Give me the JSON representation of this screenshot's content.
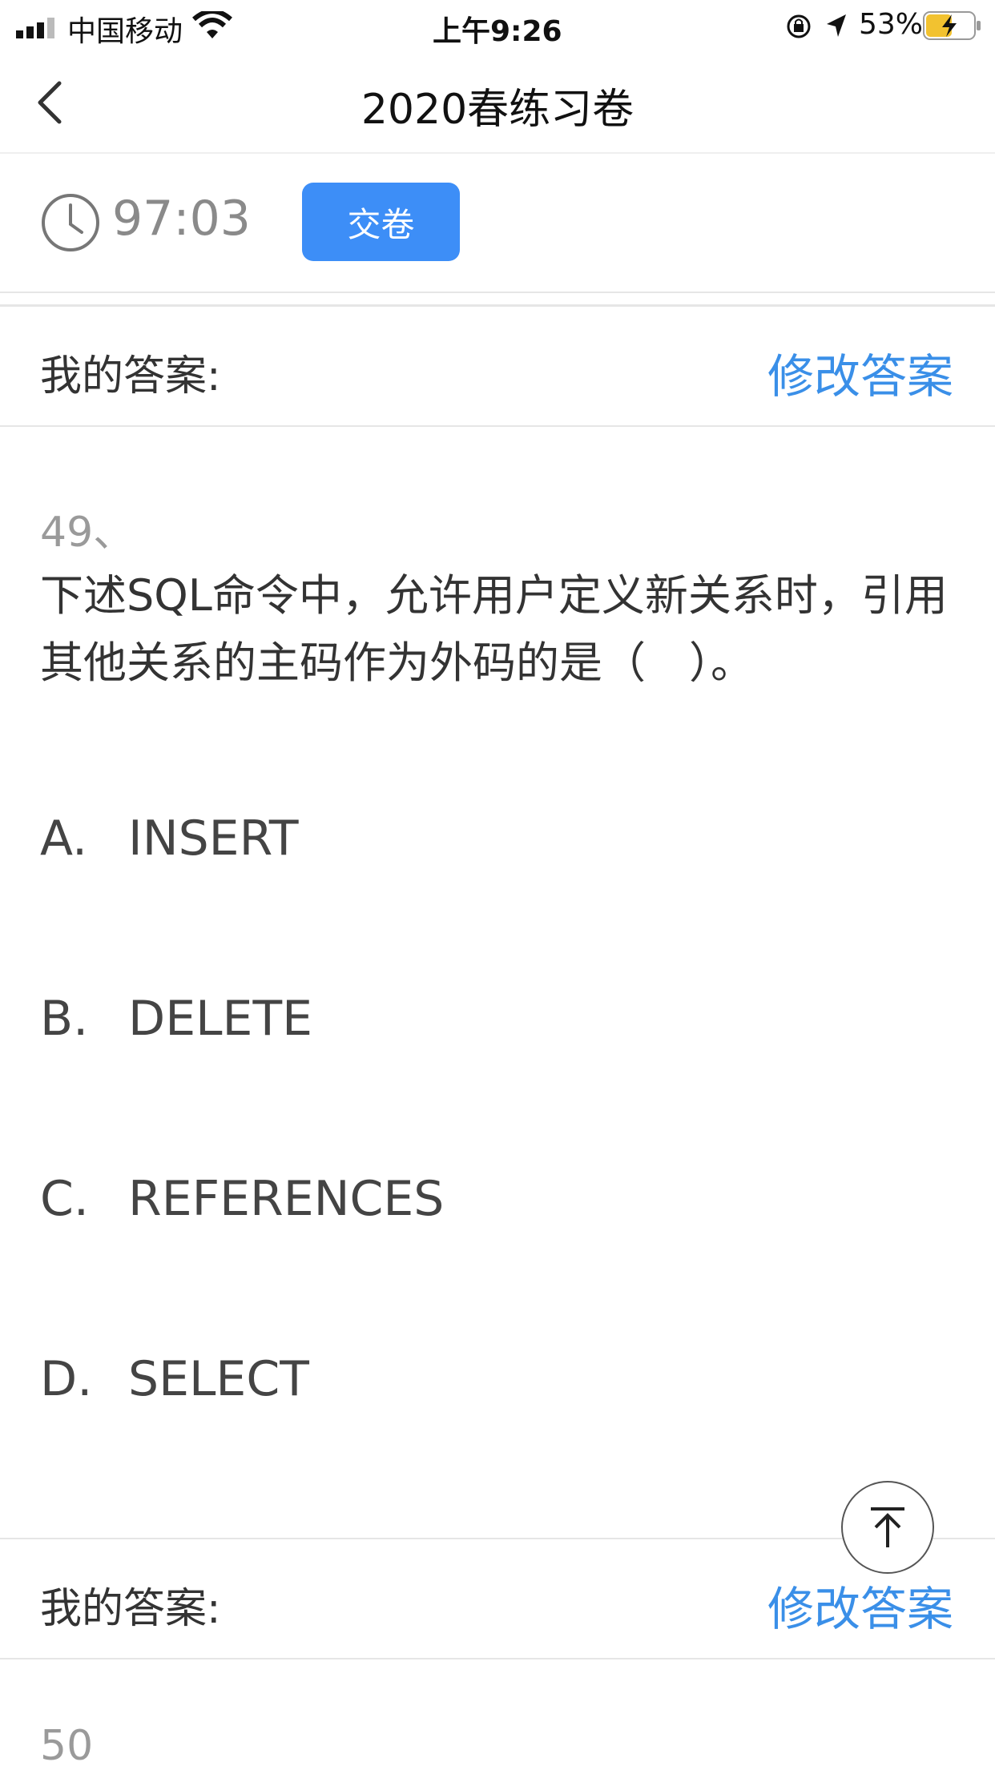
{
  "status_bar": {
    "carrier": "中国移动",
    "time": "上午9:26",
    "battery_percent": "53%",
    "battery_level": 0.53
  },
  "nav": {
    "title": "2020春练习卷"
  },
  "timer": {
    "value": "97:03",
    "submit_label": "交卷"
  },
  "answer_bar_top": {
    "label": "我的答案:",
    "edit_label": "修改答案"
  },
  "question": {
    "number": "49、",
    "text": "下述SQL命令中，允许用户定义新关系时，引用其他关系的主码作为外码的是（　）。",
    "options": [
      {
        "letter": "A.",
        "text": "INSERT"
      },
      {
        "letter": "B.",
        "text": "DELETE"
      },
      {
        "letter": "C.",
        "text": "REFERENCES"
      },
      {
        "letter": "D.",
        "text": "SELECT"
      }
    ]
  },
  "answer_bar_bottom": {
    "label": "我的答案:",
    "edit_label": "修改答案"
  },
  "next_question": {
    "number": "50"
  },
  "colors": {
    "accent": "#3d8ef7",
    "link": "#3a8fe8",
    "battery": "#f2c230"
  },
  "icons": [
    "signal-icon",
    "wifi-icon",
    "orientation-lock-icon",
    "location-icon",
    "battery-icon",
    "back-icon",
    "clock-icon",
    "scroll-top-icon"
  ]
}
